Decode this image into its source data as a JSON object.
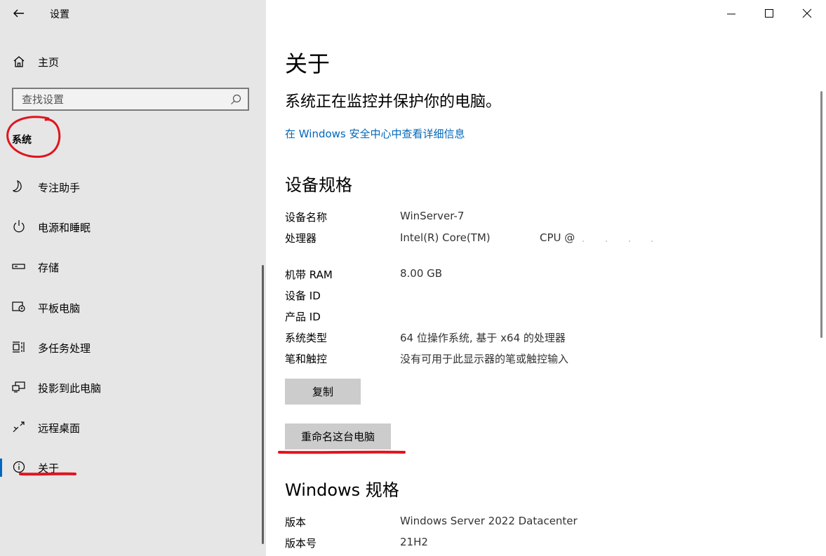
{
  "window": {
    "title": "设置"
  },
  "sidebar": {
    "home_label": "主页",
    "search_placeholder": "查找设置",
    "section_heading": "系统",
    "items": [
      {
        "label": "专注助手",
        "icon": "moon-icon"
      },
      {
        "label": "电源和睡眠",
        "icon": "power-icon"
      },
      {
        "label": "存储",
        "icon": "storage-icon"
      },
      {
        "label": "平板电脑",
        "icon": "tablet-icon"
      },
      {
        "label": "多任务处理",
        "icon": "multitasking-icon"
      },
      {
        "label": "投影到此电脑",
        "icon": "project-icon"
      },
      {
        "label": "远程桌面",
        "icon": "remote-desktop-icon"
      },
      {
        "label": "关于",
        "icon": "info-icon",
        "selected": true
      }
    ]
  },
  "main": {
    "title": "关于",
    "security_status": "系统正在监控并保护你的电脑。",
    "security_link": "在 Windows 安全中心中查看详细信息",
    "device_specs": {
      "heading": "设备规格",
      "rows": [
        {
          "label": "设备名称",
          "value": "WinServer-7"
        },
        {
          "label": "处理器",
          "value": "Intel(R) Core(TM)",
          "extra": "CPU @"
        },
        {
          "label": "机带 RAM",
          "value": "8.00 GB"
        },
        {
          "label": "设备 ID",
          "value": ""
        },
        {
          "label": "产品 ID",
          "value": ""
        },
        {
          "label": "系统类型",
          "value": "64 位操作系统, 基于 x64 的处理器"
        },
        {
          "label": "笔和触控",
          "value": "没有可用于此显示器的笔或触控输入"
        }
      ],
      "copy_button": "复制",
      "rename_button": "重命名这台电脑"
    },
    "windows_specs": {
      "heading": "Windows 规格",
      "rows": [
        {
          "label": "版本",
          "value": "Windows Server 2022 Datacenter"
        },
        {
          "label": "版本号",
          "value": "21H2"
        }
      ]
    }
  },
  "colors": {
    "sidebar_bg": "#e6e6e6",
    "link": "#0067b8",
    "accent": "#0067c0",
    "annotation": "#e0141e",
    "button_bg": "#cccccc"
  }
}
